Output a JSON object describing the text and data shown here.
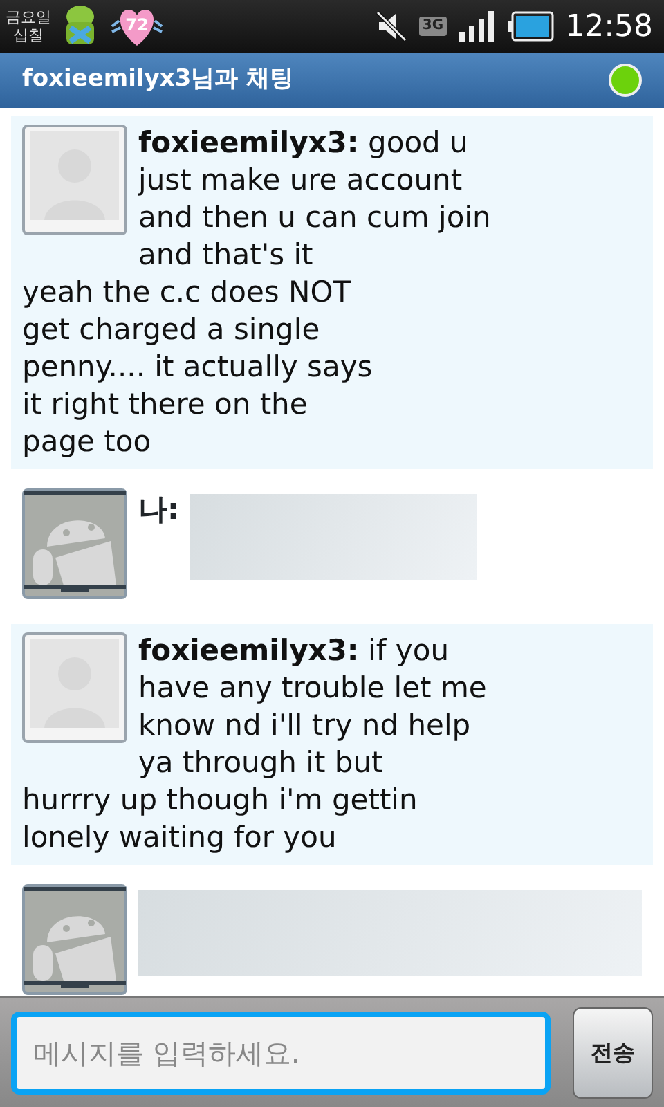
{
  "status_bar": {
    "carrier": [
      "금요일",
      "십칠"
    ],
    "notification_badge": "72",
    "network_type": "3G",
    "time": "12:58"
  },
  "header": {
    "title": "foxieemilyx3님과 채팅",
    "online": true
  },
  "messages": [
    {
      "kind": "incoming",
      "sender": "foxieemilyx3:",
      "lines": [
        "good u",
        "just make ure account",
        "and then u can cum join",
        "and that's it",
        "yeah the c.c does NOT",
        "get charged a single",
        "penny.... it actually says",
        "it right there on the",
        "page too"
      ]
    },
    {
      "kind": "outgoing",
      "sender": "나:"
    },
    {
      "kind": "incoming",
      "sender": "foxieemilyx3:",
      "lines": [
        "if you",
        "have any trouble let me",
        "know nd i'll try nd help",
        "ya through it but",
        "hurrry up though i'm gettin",
        "lonely waiting for you"
      ]
    },
    {
      "kind": "outgoing"
    }
  ],
  "composer": {
    "placeholder": "메시지를 입력하세요.",
    "focused": true,
    "send_label": "전송"
  }
}
